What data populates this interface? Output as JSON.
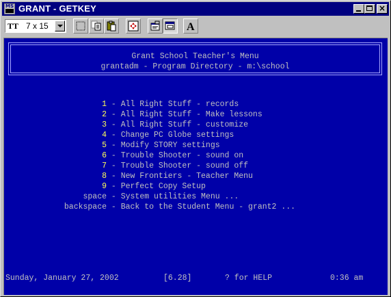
{
  "window": {
    "title": "GRANT - GETKEY",
    "icon_text": "MS"
  },
  "toolbar": {
    "font_icon": "TT",
    "font_size": "7 x 15",
    "tools": [
      "mark-icon",
      "copy-icon",
      "paste-icon",
      "fullscreen-icon",
      "properties-icon",
      "background-icon",
      "font-icon"
    ],
    "font_button_glyph": "A"
  },
  "screen": {
    "header": {
      "line1": "Grant School Teacher's Menu",
      "line2": "grantadm - Program Directory - m:\\school"
    },
    "menu": [
      {
        "key": "1",
        "text": " - All Right Stuff - records"
      },
      {
        "key": "2",
        "text": " - All Right Stuff - Make lessons"
      },
      {
        "key": "3",
        "text": " - All Right Stuff - customize"
      },
      {
        "key": "4",
        "text": " - Change PC Globe settings"
      },
      {
        "key": "5",
        "text": " - Modify STORY settings"
      },
      {
        "key": "6",
        "text": " - Trouble Shooter - sound on"
      },
      {
        "key": "7",
        "text": " - Trouble Shooter - sound off"
      },
      {
        "key": "8",
        "text": " - New Frontiers - Teacher Menu"
      },
      {
        "key": "9",
        "text": " - Perfect Copy Setup"
      },
      {
        "key": "space",
        "text": " - System utilities Menu ..."
      },
      {
        "key": "backspace",
        "text": " - Back to the Student Menu - grant2 ..."
      }
    ],
    "status": {
      "date": "Sunday, January 27, 2002",
      "version": "[6.28]",
      "help": "? for HELP",
      "time": "0:36 am"
    }
  },
  "colors": {
    "screen_bg": "#0000a8",
    "text": "#c0c0c0",
    "key_highlight": "#ffff55",
    "titlebar": "#000080"
  }
}
